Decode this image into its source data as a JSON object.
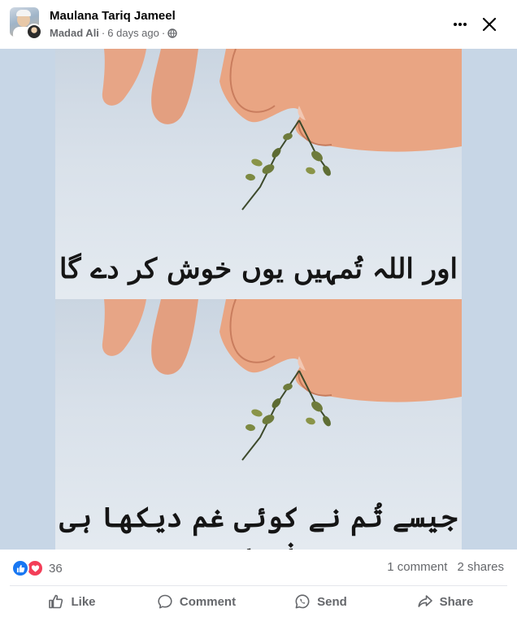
{
  "post": {
    "page_name": "Maulana Tariq Jameel",
    "author": "Madad Ali",
    "separator": "·",
    "time": "6 days ago",
    "audience_icon": "globe-icon"
  },
  "header_icons": {
    "more": "more-horizontal-icon",
    "close": "close-icon"
  },
  "image": {
    "line1": "اور اللہ تُمہیں یوں خوش کر دے گا",
    "line2": "جیسے تُم نے کوئی غم دیکھا ہی نہ ہو"
  },
  "reactions": {
    "icons": [
      "like-reaction-icon",
      "love-reaction-icon"
    ],
    "count": "36",
    "comments": "1 comment",
    "shares": "2 shares",
    "colors": {
      "like": "#1877f2",
      "love": "#f33e58"
    }
  },
  "actions": {
    "like": "Like",
    "comment": "Comment",
    "send": "Send",
    "share": "Share"
  }
}
